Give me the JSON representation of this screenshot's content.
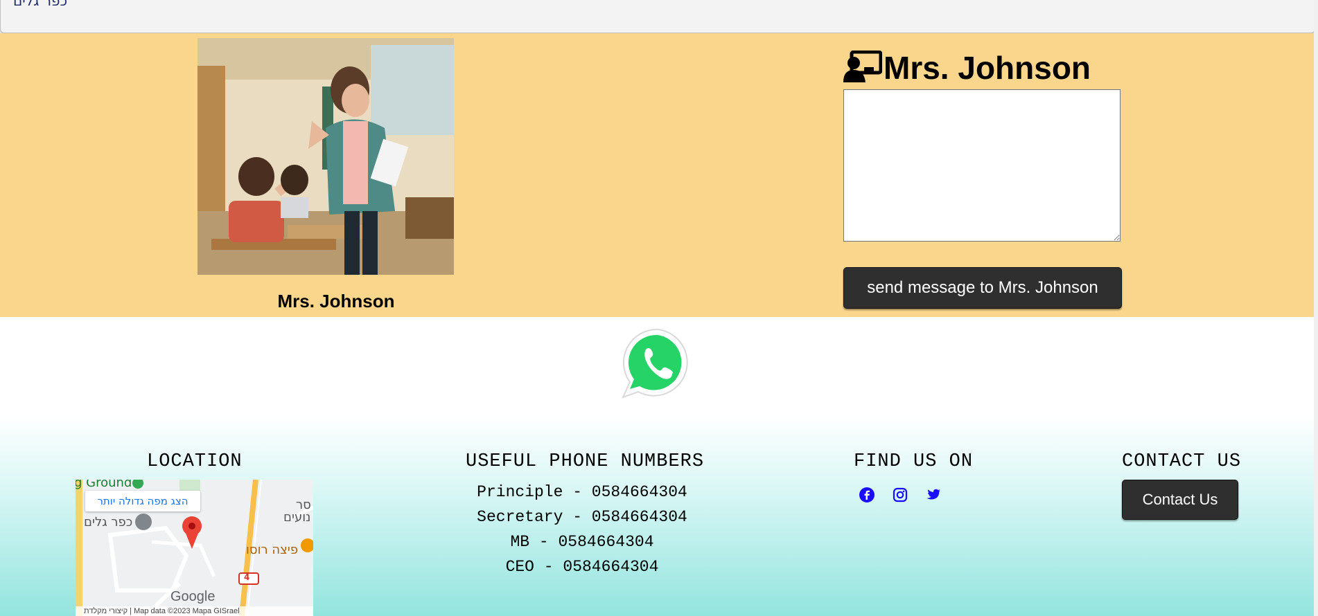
{
  "topbar": {
    "brand": "כפר גלים"
  },
  "teacher": {
    "name": "Mrs. Johnson",
    "title": "Mrs. Johnson",
    "message_value": "",
    "send_label": "send message to Mrs. Johnson"
  },
  "footer": {
    "location": {
      "title": "LOCATION",
      "map": {
        "bigger_map_label": "הצג מפה גדולה יותר",
        "labels": [
          "כפר גלים",
          "פיצה רוסו",
          "g Ground",
          "סר",
          "נועים"
        ],
        "route_badge": "4",
        "credit": "קיצורי מקלדת | Map data ©2023 Mapa GISrael",
        "logo": "Google"
      }
    },
    "phones": {
      "title": "USEFUL PHONE NUMBERS",
      "items": [
        "Principle - 0584664304",
        "Secretary - 0584664304",
        "MB - 0584664304",
        "CEO - 0584664304"
      ]
    },
    "social": {
      "title": "FIND US ON",
      "icons": [
        "facebook-icon",
        "instagram-icon",
        "twitter-icon"
      ],
      "color": "#1a0dff"
    },
    "contact": {
      "title": "CONTACT US",
      "button_label": "Contact Us"
    }
  },
  "colors": {
    "hero_bg": "#fad58c",
    "button_bg": "#2f2f2f",
    "footer_gradient_end": "#93e4de",
    "whatsapp_green": "#25d366"
  }
}
